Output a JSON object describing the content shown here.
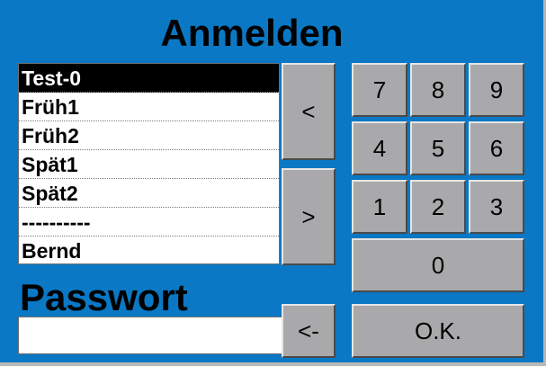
{
  "title": "Anmelden",
  "user_list": {
    "items": [
      "Test-0",
      "Früh1",
      "Früh2",
      "Spät1",
      "Spät2",
      "----------",
      "Bernd"
    ],
    "selected_index": 0
  },
  "nav": {
    "prev_label": "<",
    "next_label": ">"
  },
  "password": {
    "label": "Passwort",
    "value": ""
  },
  "keypad": {
    "keys": [
      "7",
      "8",
      "9",
      "4",
      "5",
      "6",
      "1",
      "2",
      "3"
    ],
    "zero": "0",
    "backspace": "<-",
    "ok": "O.K."
  },
  "colors": {
    "background": "#0a78c4",
    "button_face": "#a9a9ab",
    "selection": "#000000"
  }
}
